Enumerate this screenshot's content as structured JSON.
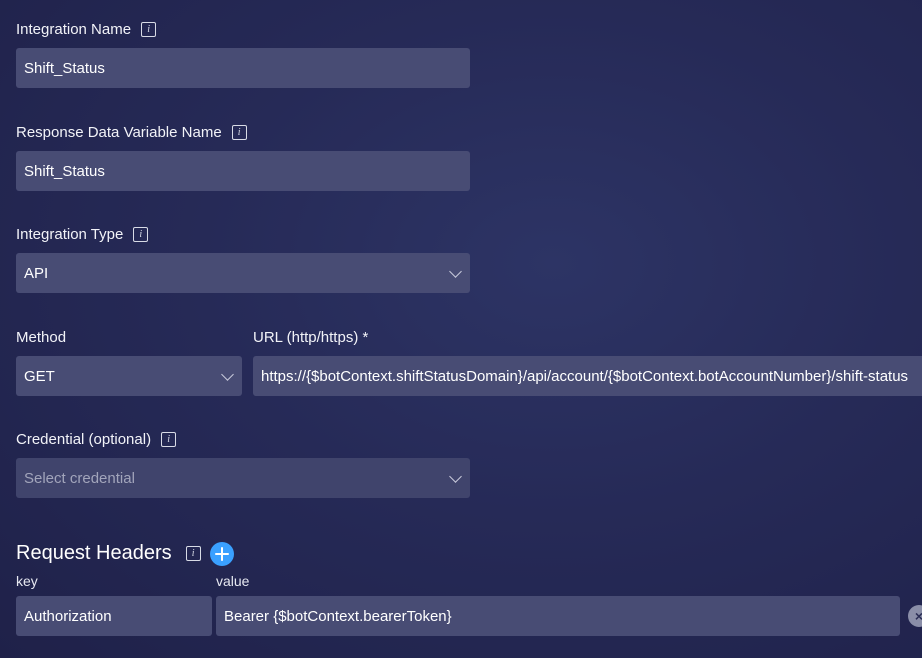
{
  "integration_name": {
    "label": "Integration Name",
    "value": "Shift_Status"
  },
  "response_variable": {
    "label": "Response Data Variable Name",
    "value": "Shift_Status"
  },
  "integration_type": {
    "label": "Integration Type",
    "value": "API"
  },
  "method": {
    "label": "Method",
    "value": "GET"
  },
  "url": {
    "label": "URL (http/https) *",
    "value": "https://{$botContext.shiftStatusDomain}/api/account/{$botContext.botAccountNumber}/shift-status"
  },
  "credential": {
    "label": "Credential (optional)",
    "placeholder": "Select credential"
  },
  "request_headers": {
    "title": "Request Headers",
    "key_label": "key",
    "value_label": "value",
    "rows": [
      {
        "key": "Authorization",
        "value": "Bearer {$botContext.bearerToken}"
      }
    ]
  },
  "icons": {
    "info": "info-icon",
    "add": "plus-icon",
    "dropdown": "chevron-down-icon",
    "remove": "close-icon"
  },
  "colors": {
    "background": "#262a57",
    "field": "#484c74",
    "accent": "#3aa0ff"
  }
}
